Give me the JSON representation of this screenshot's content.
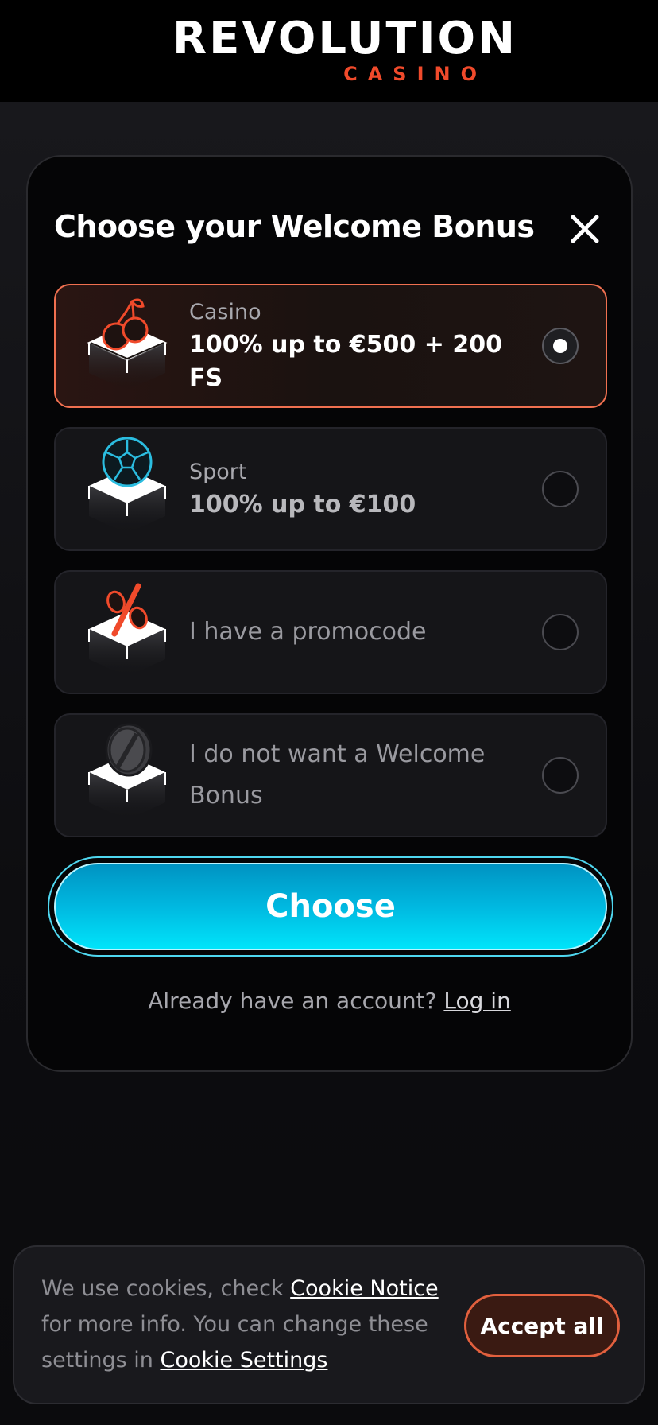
{
  "header": {
    "logo_word": "REVOLUTION",
    "logo_sub": "CASINO"
  },
  "modal": {
    "title": "Choose your Welcome Bonus",
    "options": [
      {
        "label": "Casino",
        "value": "100% up to €500 + 200 FS",
        "selected": true,
        "icon": "cherries-icon"
      },
      {
        "label": "Sport",
        "value": "100% up to €100",
        "selected": false,
        "icon": "soccer-ball-icon"
      },
      {
        "label": "I have a promocode",
        "selected": false,
        "icon": "percent-icon"
      },
      {
        "label": "I do not want a Welcome Bonus",
        "selected": false,
        "icon": "no-coin-icon"
      }
    ],
    "choose_label": "Choose",
    "login_prompt": "Already have an account?",
    "login_link": "Log in"
  },
  "cookie": {
    "text_1": "We use cookies, check",
    "link_notice": "Cookie Notice",
    "text_2": "for more info. You can change these settings in",
    "link_settings": "Cookie Settings",
    "accept_label": "Accept all"
  },
  "colors": {
    "accent_red": "#f04a2b",
    "accent_cyan": "#00c8ec",
    "background": "#131316"
  }
}
